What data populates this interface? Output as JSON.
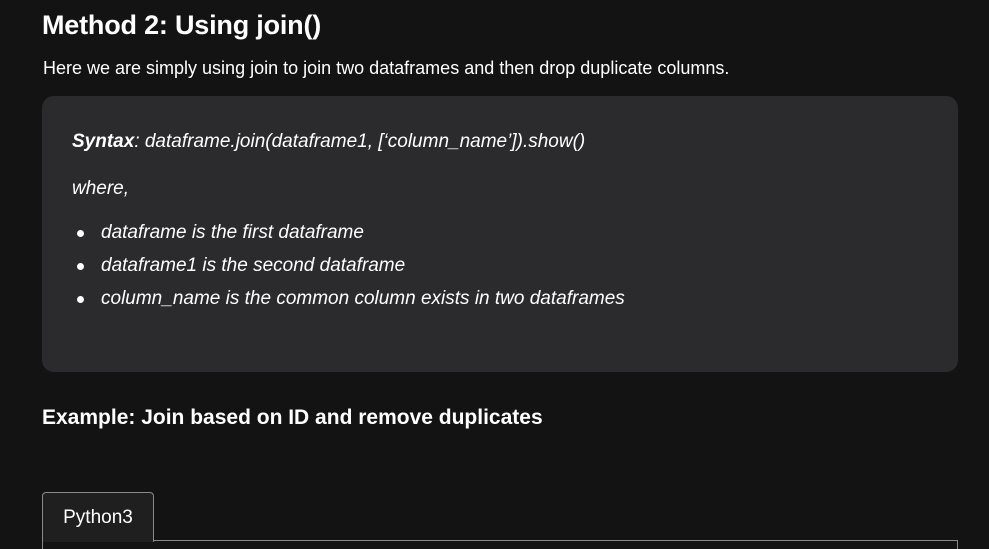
{
  "heading": "Method 2: Using join()",
  "intro": "Here we are simply using join to join two dataframes and then drop duplicate columns.",
  "syntax": {
    "label": "Syntax",
    "code": ": dataframe.join(dataframe1, [‘column_name’]).show()",
    "where": "where,",
    "bullets": [
      "dataframe is the first dataframe",
      "dataframe1 is the second dataframe",
      "column_name is the common column exists in two dataframes"
    ]
  },
  "example_heading": "Example: Join based on ID and remove duplicates",
  "code_tabs": [
    {
      "label": "Python3",
      "active": true
    }
  ]
}
